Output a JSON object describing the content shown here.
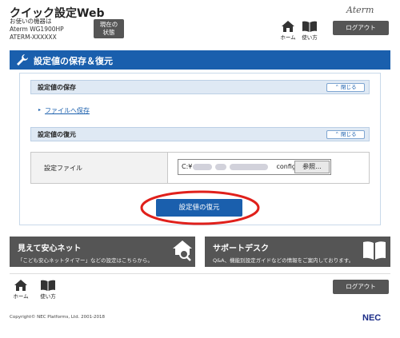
{
  "header": {
    "app_title": "クイック設定Web",
    "device_label": "お使いの機器は",
    "device_model": "Aterm WG1900HP",
    "device_id": "ATERM-XXXXXX",
    "status_button": "現在の\n状態",
    "brand": "Aterm",
    "home_label": "ホーム",
    "help_label": "使い方",
    "logout_label": "ログアウト"
  },
  "banner": {
    "title": "設定値の保存＆復元"
  },
  "save_section": {
    "title": "設定値の保存",
    "close_label": "閉じる",
    "link_label": "ファイルへ保存"
  },
  "restore_section": {
    "title": "設定値の復元",
    "close_label": "閉じる",
    "file_label": "設定ファイル",
    "file_path_prefix": "C:¥",
    "file_path_suffix": "config.bin",
    "browse_label": "参照...",
    "restore_button": "設定値の復元"
  },
  "promos": [
    {
      "title": "見えて安心ネット",
      "desc": "「こども安心ネットタイマー」などの設定はこちらから。",
      "icon": "home-search-icon"
    },
    {
      "title": "サポートデスク",
      "desc": "Q&A、機能別設定ガイドなどの情報をご案内しております。",
      "icon": "book-icon"
    }
  ],
  "footer": {
    "home_label": "ホーム",
    "help_label": "使い方",
    "logout_label": "ログアウト",
    "copyright": "Copyright© NEC Platforms, Ltd. 2001-2018",
    "logo": "NEC"
  },
  "colors": {
    "accent": "#1a5fad",
    "dark_button": "#555555",
    "highlight": "#e0201b"
  }
}
